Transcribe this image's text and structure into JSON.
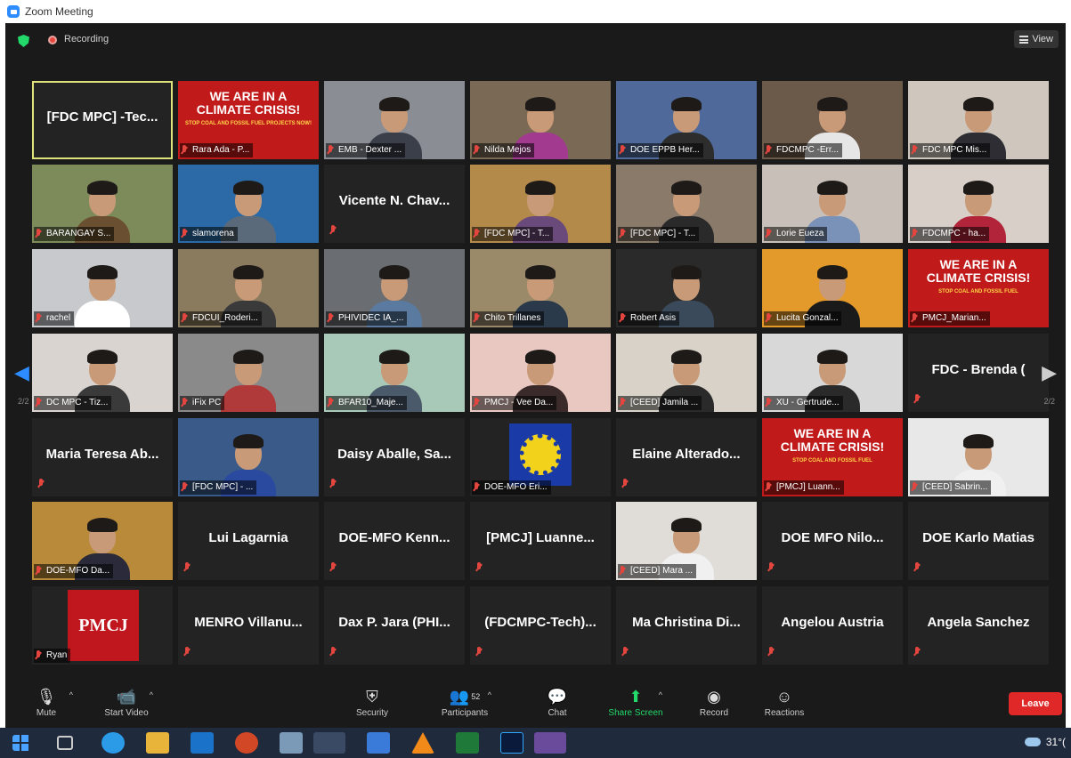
{
  "window": {
    "title": "Zoom Meeting"
  },
  "topbar": {
    "recording_label": "Recording",
    "view_label": "View"
  },
  "pager": {
    "left_page": "2/2",
    "right_page": "2/2"
  },
  "tiles": [
    {
      "name": "[FDC MPC] -Tec...",
      "mode": "text",
      "active": true
    },
    {
      "name": "Rara Ada - P...",
      "mode": "poster",
      "poster_title": "WE ARE IN A CLIMATE CRISIS!",
      "poster_sub": "STOP COAL AND FOSSIL FUEL PROJECTS NOW!"
    },
    {
      "name": "EMB - Dexter ...",
      "mode": "video",
      "bg": "#8a8e94",
      "shirt": "#3b3f4a"
    },
    {
      "name": "Nilda Mejos",
      "mode": "video",
      "bg": "#7a6a55",
      "shirt": "#a23a8f"
    },
    {
      "name": "DOE EPPB Her...",
      "mode": "video",
      "bg": "#4f6a9a",
      "shirt": "#2d2d2d"
    },
    {
      "name": "FDCMPC -Err...",
      "mode": "video",
      "bg": "#6b5a4a",
      "shirt": "#e6e6e6"
    },
    {
      "name": "FDC MPC Mis...",
      "mode": "video",
      "bg": "#cfc7bd",
      "shirt": "#2d2d33"
    },
    {
      "name": "BARANGAY S...",
      "mode": "video",
      "bg": "#7d8a5a",
      "shirt": "#6a5030"
    },
    {
      "name": "slamorena",
      "mode": "video",
      "bg": "#2b6aa6",
      "shirt": "#5a6a7a"
    },
    {
      "name": "Vicente N. Chav...",
      "mode": "text"
    },
    {
      "name": "[FDC MPC] - T...",
      "mode": "video",
      "bg": "#b48a4a",
      "shirt": "#6a4a7a"
    },
    {
      "name": "[FDC MPC] - T...",
      "mode": "video",
      "bg": "#8a7a6a",
      "shirt": "#2a2a2a"
    },
    {
      "name": "Lorie Eueza",
      "mode": "video",
      "bg": "#c8c0b8",
      "shirt": "#7a92b8"
    },
    {
      "name": "FDCMPC - ha...",
      "mode": "video",
      "bg": "#d8cfc8",
      "shirt": "#b2243a"
    },
    {
      "name": "rachel",
      "mode": "video",
      "bg": "#c7c9cc",
      "shirt": "#ffffff"
    },
    {
      "name": "FDCUI_Roderi...",
      "mode": "video",
      "bg": "#8a7a5e",
      "shirt": "#3a3a3a"
    },
    {
      "name": "PHIVIDEC IA_...",
      "mode": "video",
      "bg": "#6a6e72",
      "shirt": "#5a7aa0"
    },
    {
      "name": "Chito Trillanes",
      "mode": "video",
      "bg": "#9a8a6a",
      "shirt": "#2a3a4a"
    },
    {
      "name": "Robert Asis",
      "mode": "video",
      "bg": "#2a2a2a",
      "shirt": "#3a4a5a"
    },
    {
      "name": "Lucita Gonzal...",
      "mode": "video",
      "bg": "#e39a2a",
      "shirt": "#1a1a1a"
    },
    {
      "name": "PMCJ_Marian...",
      "mode": "poster",
      "poster_title": "WE ARE IN A CLIMATE CRISIS!",
      "poster_sub": "STOP COAL AND FOSSIL FUEL"
    },
    {
      "name": "DC MPC - Tiz...",
      "mode": "video",
      "bg": "#d9d4d0",
      "shirt": "#3a3a3a"
    },
    {
      "name": "iFix PC",
      "mode": "video",
      "bg": "#8a8a8a",
      "shirt": "#b03a3a"
    },
    {
      "name": "BFAR10_Maje...",
      "mode": "video",
      "bg": "#a8c8b8",
      "shirt": "#4a5a6a"
    },
    {
      "name": "PMCJ - Vee Da...",
      "mode": "video",
      "bg": "#e8c8c0",
      "shirt": "#3a2a2a"
    },
    {
      "name": "[CEED] Jamila ...",
      "mode": "video",
      "bg": "#d8d2c8",
      "shirt": "#2a2a2a"
    },
    {
      "name": "XU - Gertrude...",
      "mode": "video",
      "bg": "#d8d8d8",
      "shirt": "#2a2a2a"
    },
    {
      "name": "FDC - Brenda (",
      "mode": "text"
    },
    {
      "name": "Maria Teresa Ab...",
      "mode": "text"
    },
    {
      "name": "[FDC MPC] - ...",
      "mode": "video",
      "bg": "#3a5a8a",
      "shirt": "#2a4aa0"
    },
    {
      "name": "Daisy Aballe, Sa...",
      "mode": "text"
    },
    {
      "name": "DOE-MFO Eri...",
      "mode": "sun"
    },
    {
      "name": "Elaine Alterado...",
      "mode": "text"
    },
    {
      "name": "[PMCJ] Luann...",
      "mode": "poster",
      "poster_title": "WE ARE IN A CLIMATE CRISIS!",
      "poster_sub": "STOP COAL AND FOSSIL FUEL"
    },
    {
      "name": "[CEED] Sabrin...",
      "mode": "video",
      "bg": "#e8e8e8",
      "shirt": "#f0f0f0"
    },
    {
      "name": "DOE-MFO Da...",
      "mode": "video",
      "bg": "#b88a3a",
      "shirt": "#2a2a3a"
    },
    {
      "name": "Lui Lagarnia",
      "mode": "text"
    },
    {
      "name": "DOE-MFO Kenn...",
      "mode": "text"
    },
    {
      "name": "[PMCJ] Luanne...",
      "mode": "text"
    },
    {
      "name": "[CEED] Mara ...",
      "mode": "video",
      "bg": "#e0dcd8",
      "shirt": "#f0f0f0"
    },
    {
      "name": "DOE MFO Nilo...",
      "mode": "text"
    },
    {
      "name": "DOE Karlo Matias",
      "mode": "text"
    },
    {
      "name": "Ryan",
      "mode": "pmcj",
      "logo_text": "PMCJ"
    },
    {
      "name": "MENRO Villanu...",
      "mode": "text"
    },
    {
      "name": "Dax P. Jara (PHI...",
      "mode": "text"
    },
    {
      "name": "(FDCMPC-Tech)...",
      "mode": "text"
    },
    {
      "name": "Ma Christina Di...",
      "mode": "text"
    },
    {
      "name": "Angelou Austria",
      "mode": "text"
    },
    {
      "name": "Angela Sanchez",
      "mode": "text"
    }
  ],
  "toolbar": {
    "mute": "Mute",
    "start_video": "Start Video",
    "security": "Security",
    "participants": "Participants",
    "participant_count": "52",
    "chat": "Chat",
    "share_screen": "Share Screen",
    "record": "Record",
    "reactions": "Reactions",
    "leave": "Leave"
  },
  "taskbar": {
    "temperature": "31°("
  },
  "colors": {
    "accent": "#2d8cff",
    "leave": "#e02828",
    "share": "#23d96a",
    "active_border": "#dfe37a"
  }
}
